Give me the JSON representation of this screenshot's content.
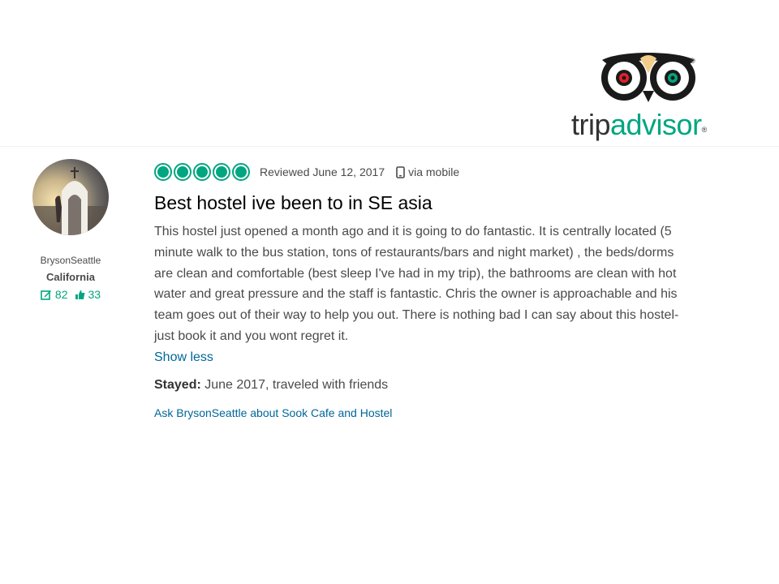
{
  "brand": {
    "logo_trip": "trip",
    "logo_advisor": "advisor",
    "registered_mark": "®",
    "colors": {
      "green": "#00a680",
      "owl_red": "#e4202a",
      "link": "#006699",
      "text": "#4a4a4a"
    }
  },
  "reviewer": {
    "avatar_icon": "user-avatar-photo",
    "username": "BrysonSeattle",
    "location": "California",
    "review_count": "82",
    "helpful_votes": "33"
  },
  "review": {
    "rating": 5,
    "rating_max": 5,
    "date_text": "Reviewed June 12, 2017",
    "via_text": "via mobile",
    "title": "Best hostel ive been to in SE asia",
    "body": "This hostel just opened a month ago and it is going to do fantastic. It is centrally located (5 minute walk to the bus station, tons of restaurants/bars and night market) , the beds/dorms are clean and comfortable (best sleep I've had in my trip), the bathrooms are clean with hot water and great pressure and the staff is fantastic. Chris the owner is approachable and his team goes out of their way to help you out. There is nothing bad I can say about this hostel- just book it and you wont regret it.",
    "show_less": "Show less",
    "stayed_label": "Stayed:",
    "stayed_value": " June 2017, traveled with friends",
    "ask_link": "Ask BrysonSeattle about Sook Cafe and Hostel"
  }
}
